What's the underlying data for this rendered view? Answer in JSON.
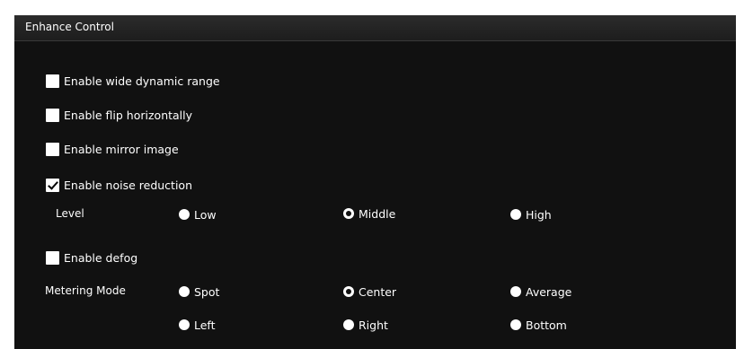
{
  "panel": {
    "title": "Enhance Control"
  },
  "checkboxes": [
    {
      "label": "Enable wide dynamic range",
      "checked": false
    },
    {
      "label": "Enable flip horizontally",
      "checked": false
    },
    {
      "label": "Enable mirror image",
      "checked": false
    },
    {
      "label": "Enable noise reduction",
      "checked": true
    },
    {
      "label": "Enable defog",
      "checked": false
    }
  ],
  "level": {
    "label": "Level",
    "options": [
      "Low",
      "Middle",
      "High"
    ],
    "selected": "Middle"
  },
  "metering": {
    "label": "Metering Mode",
    "options": [
      "Spot",
      "Center",
      "Average",
      "Left",
      "Right",
      "Bottom"
    ],
    "selected": "Center"
  },
  "colors": {
    "panel_background": "#111111",
    "header_background": "#2a2a2a",
    "text": "#ffffff"
  }
}
